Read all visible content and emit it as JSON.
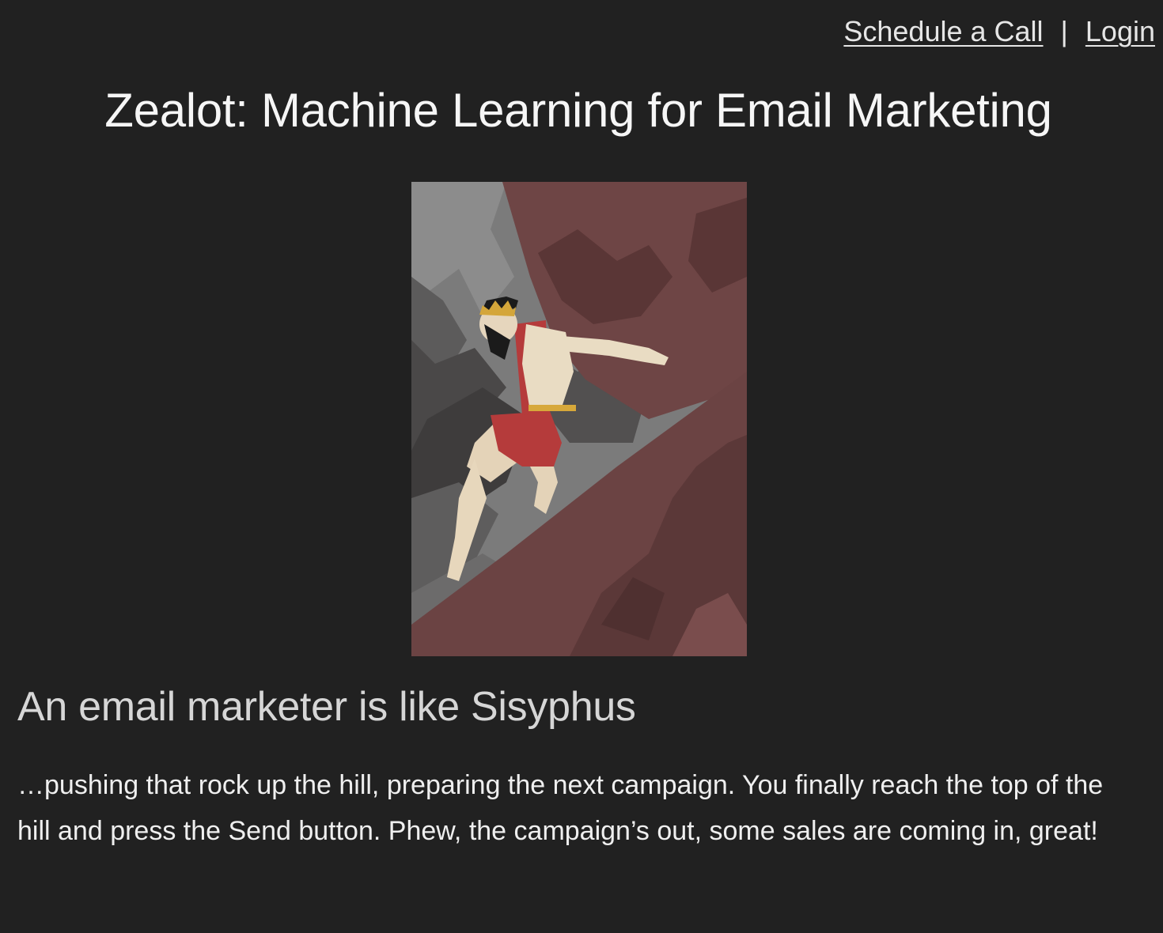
{
  "nav": {
    "schedule_label": "Schedule a Call",
    "separator": "|",
    "login_label": "Login"
  },
  "header": {
    "title": "Zealot: Machine Learning for Email Marketing"
  },
  "hero": {
    "alt": "Sisyphus illustration"
  },
  "content": {
    "subtitle": "An email marketer is like Sisyphus",
    "paragraph": "…pushing that rock up the hill, preparing the next campaign. You finally reach the top of the hill and press the Send button. Phew, the campaign’s out, some sales are coming in, great!"
  },
  "colors": {
    "background": "#212121",
    "text": "#f4f4f4",
    "rock": "#6b4242",
    "tunic": "#b33a3a"
  }
}
